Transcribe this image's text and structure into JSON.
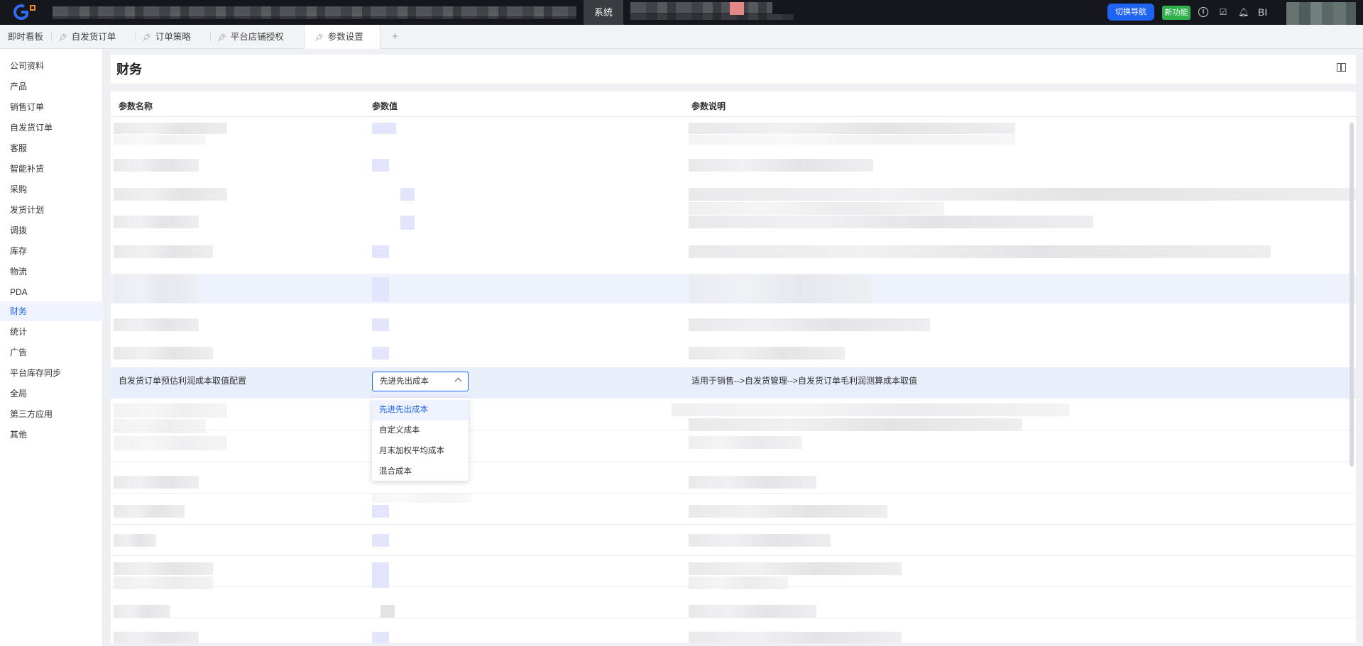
{
  "topbar": {
    "system_tab": "系统",
    "switch_nav": "切换导航",
    "new_feature": "新功能",
    "bi": "BI",
    "icons": [
      "help-icon",
      "task-icon",
      "bell-icon"
    ]
  },
  "tabs": [
    {
      "label": "即时看板",
      "pinned": false
    },
    {
      "label": "自发货订单",
      "pinned": true
    },
    {
      "label": "订单策略",
      "pinned": true
    },
    {
      "label": "平台店铺授权",
      "pinned": true
    },
    {
      "label": "参数设置",
      "pinned": true,
      "active": true
    }
  ],
  "tab_add": "+",
  "sidebar": {
    "items": [
      "公司资料",
      "产品",
      "销售订单",
      "自发货订单",
      "客服",
      "智能补货",
      "采购",
      "发货计划",
      "调拨",
      "库存",
      "物流",
      "PDA",
      "财务",
      "统计",
      "广告",
      "平台库存同步",
      "全局",
      "第三方应用",
      "其他"
    ],
    "active": "财务"
  },
  "page": {
    "title": "财务"
  },
  "table": {
    "columns": [
      "参数名称",
      "参数值",
      "参数说明"
    ],
    "target_row": {
      "name": "自发货订单预估利润成本取值配置",
      "value": "先进先出成本",
      "description": "适用于销售-->自发货管理-->自发货订单毛利润测算成本取值"
    }
  },
  "dropdown": {
    "options": [
      "先进先出成本",
      "自定义成本",
      "月末加权平均成本",
      "混合成本"
    ],
    "selected": "先进先出成本"
  },
  "colors": {
    "accent": "#1f63f2",
    "new_badge": "#2fb04b",
    "topbar_bg": "#15171c"
  }
}
